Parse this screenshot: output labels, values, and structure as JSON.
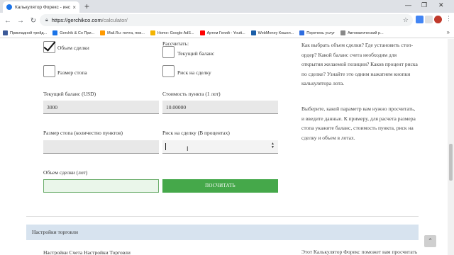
{
  "browser": {
    "tab_title": "Калькулятор Форекс - инструм",
    "tab_close": "×",
    "new_tab": "+",
    "window_controls": [
      "—",
      "❐",
      "✕"
    ],
    "url_host": "https://gerchikco.com",
    "url_path": "/calculator/",
    "star": "☆",
    "bookmarks": [
      {
        "label": "Прикладной трейд...",
        "color": "#3b5998"
      },
      {
        "label": "Gerchik & Co При...",
        "color": "#1a73e8"
      },
      {
        "label": "Mail.Ru: почта, пои...",
        "color": "#ff9900"
      },
      {
        "label": "Home: Google AdS...",
        "color": "#f4b400"
      },
      {
        "label": "Артем Гелий - Youtt...",
        "color": "#ff0000"
      },
      {
        "label": "WebMoney Кошел...",
        "color": "#1a5ea8"
      },
      {
        "label": "Перечень услуг",
        "color": "#2d6cdf"
      },
      {
        "label": "Автоматический р...",
        "color": "#888888"
      }
    ],
    "bookmarks_more": "»"
  },
  "form": {
    "lots_checkbox_label": "Объем сделки",
    "calculate_label": "Рассчитать:",
    "balance_checkbox_label": "Текущий баланс",
    "stop_checkbox_label": "Размер стопа",
    "risk_checkbox_label": "Риск на сделку",
    "balance_label": "Текущий баланс (USD)",
    "balance_value": "3000",
    "pip_cost_label": "Стоимость пункта (1 лот)",
    "pip_cost_value": "10.00000",
    "stop_size_label": "Размер стопа (количество пунктов)",
    "stop_size_value": "",
    "risk_label": "Риск на сделку (В процентах)",
    "risk_value": "",
    "lots_label": "Объем сделки (лот)",
    "lots_value": "",
    "calc_button": "ПОСЧИТАТЬ",
    "lots_checked": true
  },
  "sidebar_text": {
    "paragraph1_lines": [
      "Как выбрать объем сделки? Где установить стоп-",
      "ордер? Какой баланс счета необходим для",
      "открытия желаемой позиции? Каков процент риска",
      "по сделке? Узнайте это одним нажатием кнопки",
      "калькулятора лота."
    ],
    "paragraph2_lines": [
      "Выберите, какой параметр вам нужно просчитать,",
      "и введите данные. К примеру, для расчета размера",
      "стопа укажите баланс, стоимость пункта, риск на",
      "сделку и объем в лотах."
    ],
    "bottom_partial": "Этот Калькулятор Форекс поможет вам просчитать"
  },
  "settings": {
    "title": "Настройки торговли",
    "subtitle": "Настройки Счета Настройки Торговли"
  },
  "scroll_top_icon": "⌃"
}
